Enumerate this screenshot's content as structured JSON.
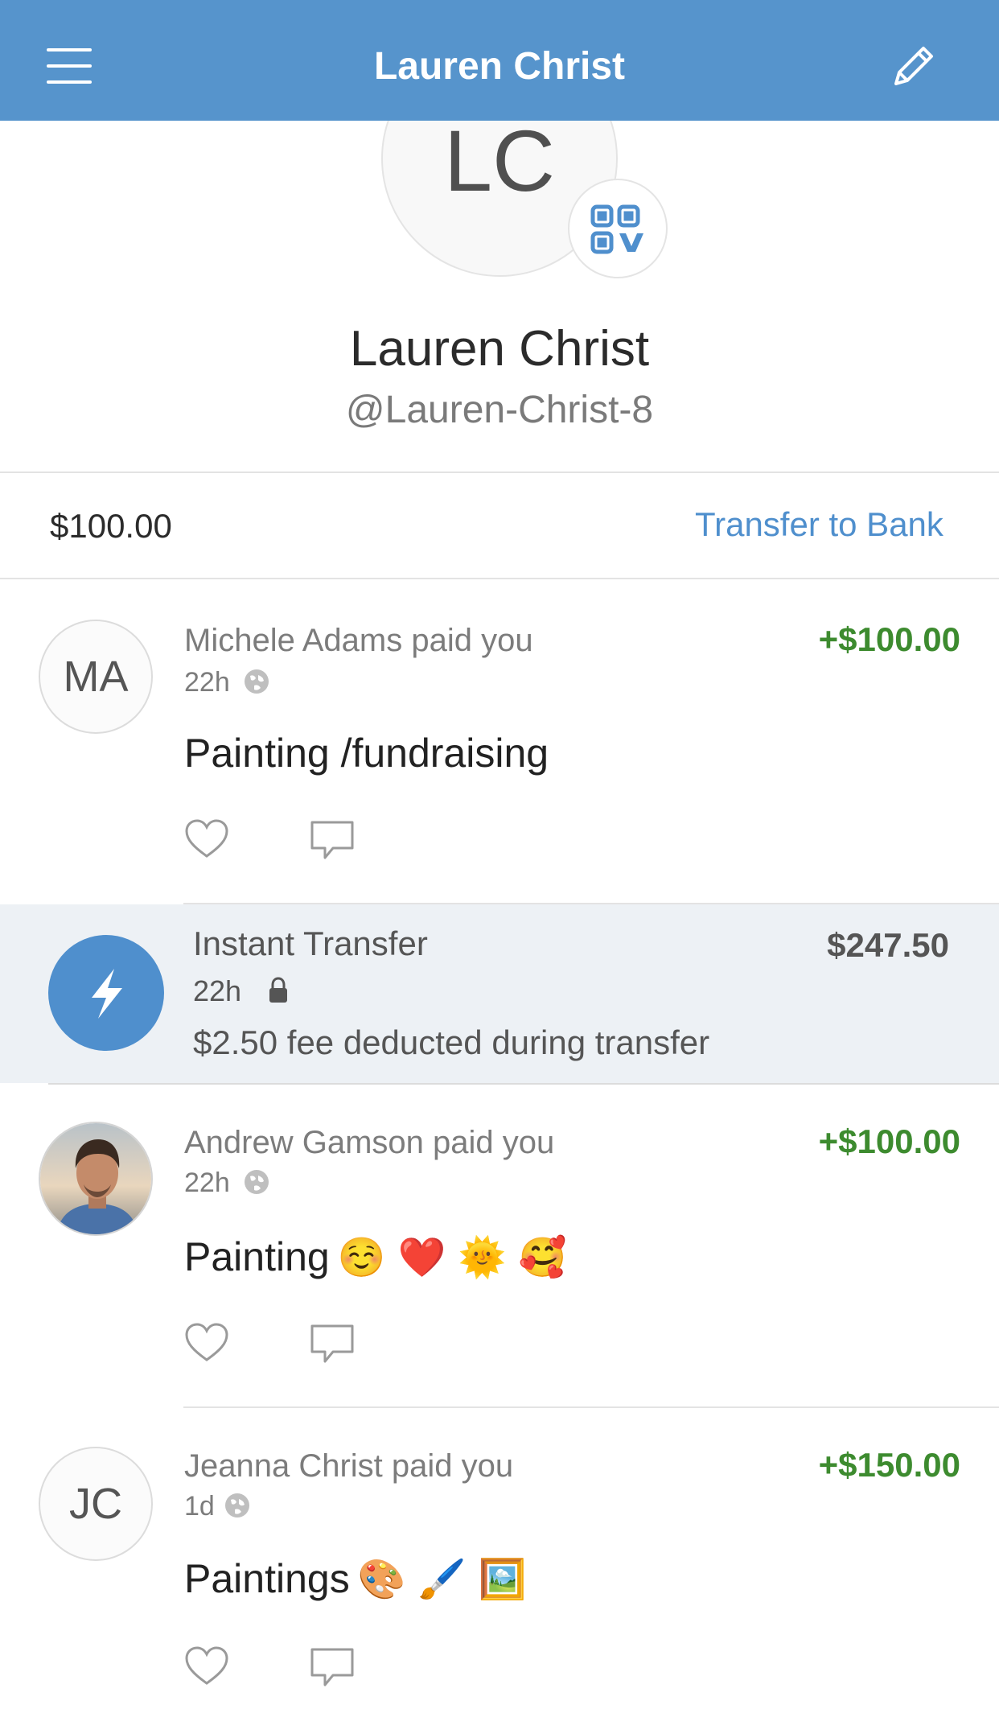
{
  "header": {
    "title": "Lauren Christ"
  },
  "profile": {
    "initials": "LC",
    "name": "Lauren Christ",
    "handle": "@Lauren-Christ-8"
  },
  "balance": {
    "amount": "$100.00",
    "transfer_label": "Transfer to Bank"
  },
  "feed": [
    {
      "initials": "MA",
      "title": "Michele Adams paid you",
      "time": "22h",
      "amount": "+$100.00",
      "note": "Painting /fundraising",
      "emojis": ""
    },
    {
      "title": "Instant Transfer",
      "time": "22h",
      "amount": "$247.50",
      "note": "$2.50 fee deducted during transfer"
    },
    {
      "title": "Andrew Gamson paid you",
      "time": "22h",
      "amount": "+$100.00",
      "note": "Painting",
      "emojis": "☺️ ❤️ 🌞 🥰"
    },
    {
      "initials": "JC",
      "title": "Jeanna Christ paid you",
      "time": "1d",
      "amount": "+$150.00",
      "note": "Paintings",
      "emojis": "🎨 🖌️ 🖼️"
    }
  ],
  "colors": {
    "nav_bar": "#5694cc",
    "link": "#4f8fcd",
    "positive_amount": "#3d8b2f",
    "transfer_row_bg": "#edf1f5"
  },
  "icons": {
    "menu": "hamburger-icon",
    "edit": "pencil-icon",
    "qr": "qr-code-icon",
    "privacy_public": "globe-icon",
    "privacy_private": "lock-icon",
    "like": "heart-icon",
    "comment": "comment-icon",
    "instant": "lightning-icon"
  }
}
